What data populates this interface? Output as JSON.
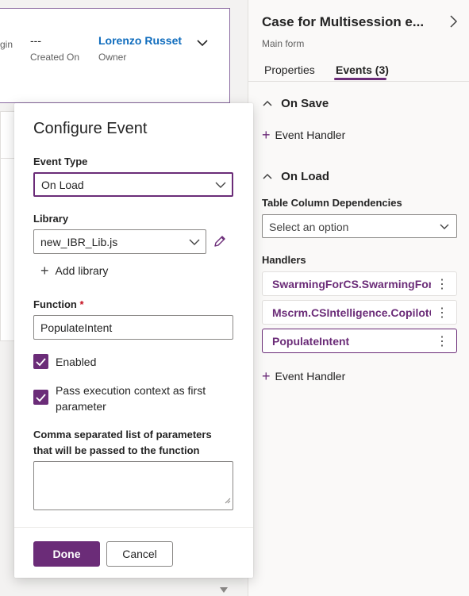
{
  "header": {
    "origin_value": "",
    "origin_label": "gin",
    "created_on_value": "---",
    "created_on_label": "Created On",
    "owner_value": "Lorenzo Russet",
    "owner_label": "Owner"
  },
  "pane": {
    "title": "Case for Multisession e...",
    "subtitle": "Main form",
    "tabs": [
      {
        "label": "Properties",
        "selected": false
      },
      {
        "label": "Events (3)",
        "selected": true
      }
    ],
    "on_save_title": "On Save",
    "on_load_title": "On Load",
    "add_handler_label": "Event Handler",
    "deps_label": "Table Column Dependencies",
    "deps_placeholder": "Select an option",
    "handlers_label": "Handlers",
    "handlers": [
      {
        "name": "SwarmingForCS.SwarmingForCS"
      },
      {
        "name": "Mscrm.CSIntelligence.CopilotCase"
      },
      {
        "name": "PopulateIntent"
      }
    ],
    "accent": "#6b2c78"
  },
  "dialog": {
    "title": "Configure Event",
    "event_type_label": "Event Type",
    "event_type_value": "On Load",
    "library_label": "Library",
    "library_value": "new_IBR_Lib.js",
    "add_library_label": "Add library",
    "function_label": "Function",
    "required_mark": "*",
    "function_value": "PopulateIntent",
    "enabled_label": "Enabled",
    "enabled_checked": true,
    "pass_context_label": "Pass execution context as first parameter",
    "pass_context_checked": true,
    "params_label": "Comma separated list of parameters that will be passed to the function",
    "params_value": "",
    "done_label": "Done",
    "cancel_label": "Cancel"
  },
  "icons": {
    "chevron_down": "chevron-down-icon",
    "chevron_right": "chevron-right-icon",
    "chevron_up": "chevron-up-icon",
    "edit": "pencil-icon",
    "add": "plus-icon",
    "more": "more-vertical-icon",
    "check": "checkmark-icon"
  }
}
